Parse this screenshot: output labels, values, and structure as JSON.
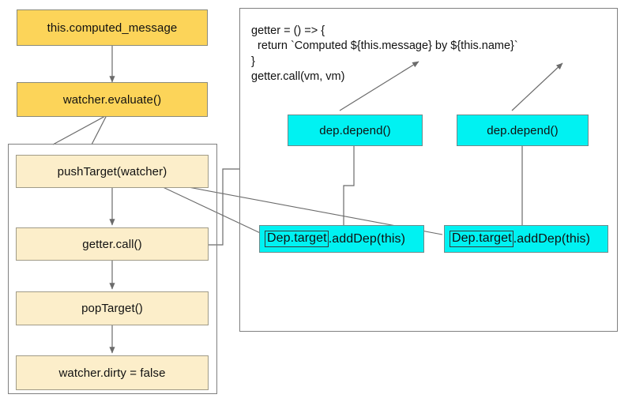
{
  "diagram": {
    "title": "Vue computed property evaluation flow",
    "colors": {
      "yellow": "#FCD459",
      "cream": "#FCEECA",
      "cyan": "#00F2F2",
      "border": "#808080",
      "edge": "#6b6b6b",
      "text": "#111111"
    }
  },
  "left_flow": {
    "entry": {
      "label": "this.computed_message"
    },
    "evaluate": {
      "label": "watcher.evaluate()"
    },
    "steps": [
      {
        "label": "pushTarget(watcher)"
      },
      {
        "label": "getter.call()"
      },
      {
        "label": "popTarget()"
      },
      {
        "label": "watcher.dirty = false"
      }
    ]
  },
  "right_panel": {
    "code": "getter = () => {\n  return `Computed ${this.message} by ${this.name}`\n}\ngetter.call(vm, vm)",
    "code_lines": [
      "getter = () => {",
      "  return `Computed ${this.message} by ${this.name}`",
      "}",
      "getter.call(vm, vm)"
    ],
    "depend_nodes": [
      {
        "label": "dep.depend()"
      },
      {
        "label": "dep.depend()"
      }
    ],
    "adddep_nodes": [
      {
        "boxed": "Dep.target",
        "rest": ".addDep(this)"
      },
      {
        "boxed": "Dep.target",
        "rest": ".addDep(this)"
      }
    ]
  }
}
